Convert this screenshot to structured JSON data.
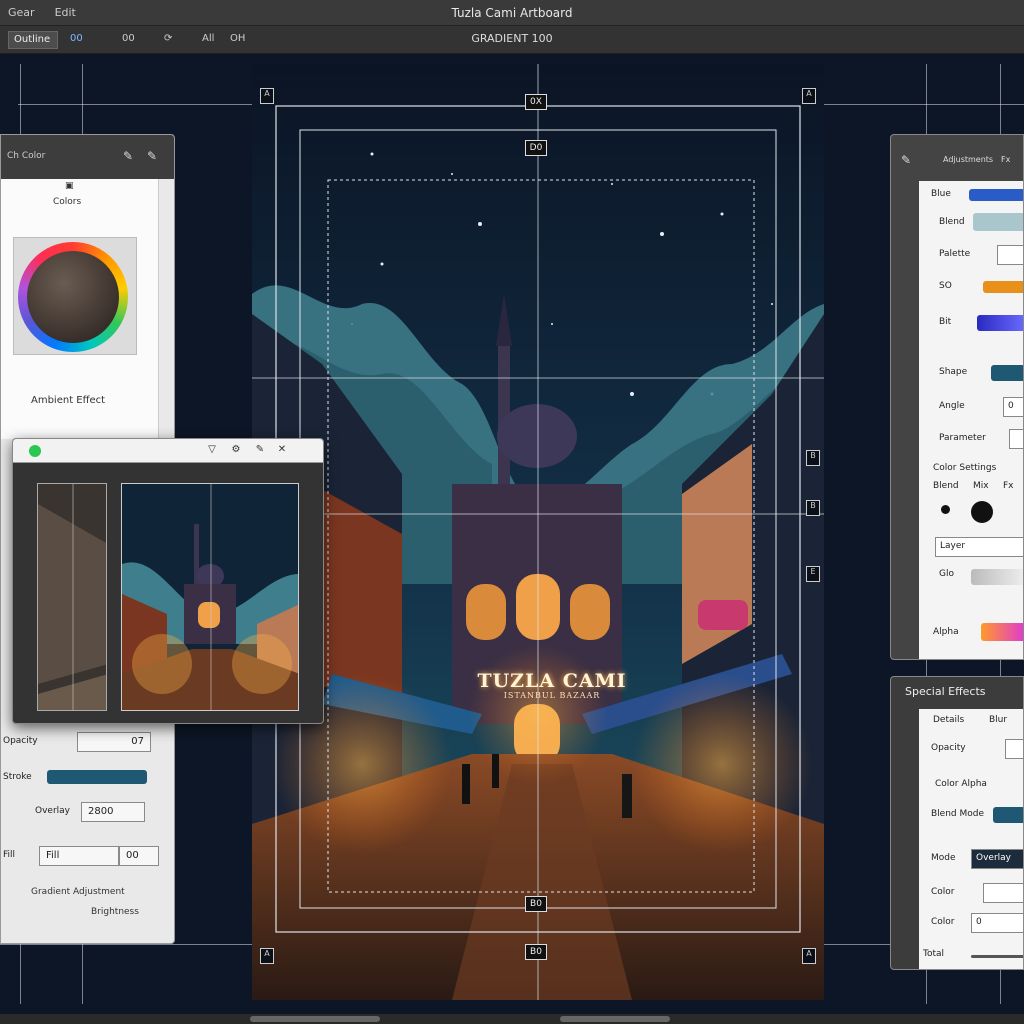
{
  "app": {
    "title": "Tuzla Cami Artboard",
    "menu": [
      "Gear",
      "Edit"
    ]
  },
  "toolbar": {
    "field_label": "Outline",
    "btn_a": "00",
    "btn_b": "00",
    "btn_c": "All",
    "btn_d": "OH",
    "zoom_label": "GRADIENT 100"
  },
  "artwork": {
    "sign_title": "TUZLA CAMI",
    "sign_subtitle": "ISTANBUL BAZAAR",
    "handles": [
      "0X",
      "D0",
      "B0",
      "B0"
    ],
    "side_handles": [
      "B",
      "B",
      "E"
    ]
  },
  "left_panel": {
    "header": "Ch  Color",
    "subtitle": "Colors",
    "wheel_label": "Color",
    "section": "Ambient Effect",
    "rows": [
      {
        "label": "Opacity",
        "value": "07"
      },
      {
        "label": "Stroke",
        "value": ""
      },
      {
        "label": "Overlay",
        "value": "2800"
      },
      {
        "label": "Fill",
        "value_a": "Fill",
        "value_b": "00"
      }
    ],
    "footer_a": "Gradient Adjustment",
    "footer_b": "Brightness"
  },
  "preview_window": {
    "icons": [
      "filter-icon",
      "settings-icon",
      "brush-icon",
      "close-icon"
    ]
  },
  "right_panel": {
    "tabs": [
      "Adjustments",
      "Fx"
    ],
    "rows": [
      {
        "label": "Blue",
        "color": "#2a5cc8"
      },
      {
        "label": "Blend",
        "color": "#a9c6cc"
      },
      {
        "label": "Palette",
        "value": ""
      },
      {
        "label": "SO",
        "color": "#e8901a"
      },
      {
        "label": "Bit",
        "color": "#3c3ad8"
      },
      {
        "label": "Shape",
        "color": "#1f5873"
      },
      {
        "label": "Angle",
        "value": "0"
      },
      {
        "label": "Parameter",
        "value": ""
      }
    ],
    "section": "Color Settings",
    "toggle_labels": [
      "Blend",
      "Mix",
      "Fx"
    ],
    "layer_field": "Layer",
    "gradient_label": "Glo",
    "alpha_label": "Alpha"
  },
  "special_panel": {
    "title": "Special Effects",
    "cols": [
      "Details",
      "Blur"
    ],
    "rows": [
      {
        "label": "Opacity",
        "value": ""
      },
      {
        "label": "Color Alpha",
        "value": ""
      },
      {
        "label": "Blend Mode",
        "color": "#1f5873"
      },
      {
        "label": "Mode",
        "value": "Overlay"
      },
      {
        "label": "Color",
        "value": ""
      },
      {
        "label": "Color",
        "value": "0"
      },
      {
        "label": "Total",
        "value": ""
      }
    ]
  }
}
